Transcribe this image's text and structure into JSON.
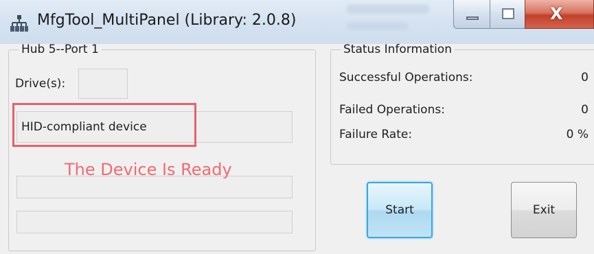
{
  "window": {
    "title": "MfgTool_MultiPanel (Library: 2.0.8)",
    "app_icon": "usb-hub-icon",
    "controls": {
      "minimize": "minimize-icon",
      "maximize": "maximize-icon",
      "close_glyph": "X"
    }
  },
  "hub_group": {
    "legend": "Hub 5--Port 1",
    "drive_label": "Drive(s):",
    "drive_value": "",
    "device_name": "HID-compliant device",
    "ready_message": "The Device Is Ready",
    "progress1": "",
    "progress2": ""
  },
  "status_group": {
    "legend": "Status Information",
    "rows": [
      {
        "label": "Successful Operations:",
        "value": "0"
      },
      {
        "label": "Failed Operations:",
        "value": "0"
      },
      {
        "label": "Failure Rate:",
        "value": "0 %"
      }
    ]
  },
  "buttons": {
    "start": "Start",
    "exit": "Exit"
  },
  "colors": {
    "highlight": "#e8606c",
    "ready_text": "#ef6b72",
    "start_border": "#38a7e1"
  }
}
